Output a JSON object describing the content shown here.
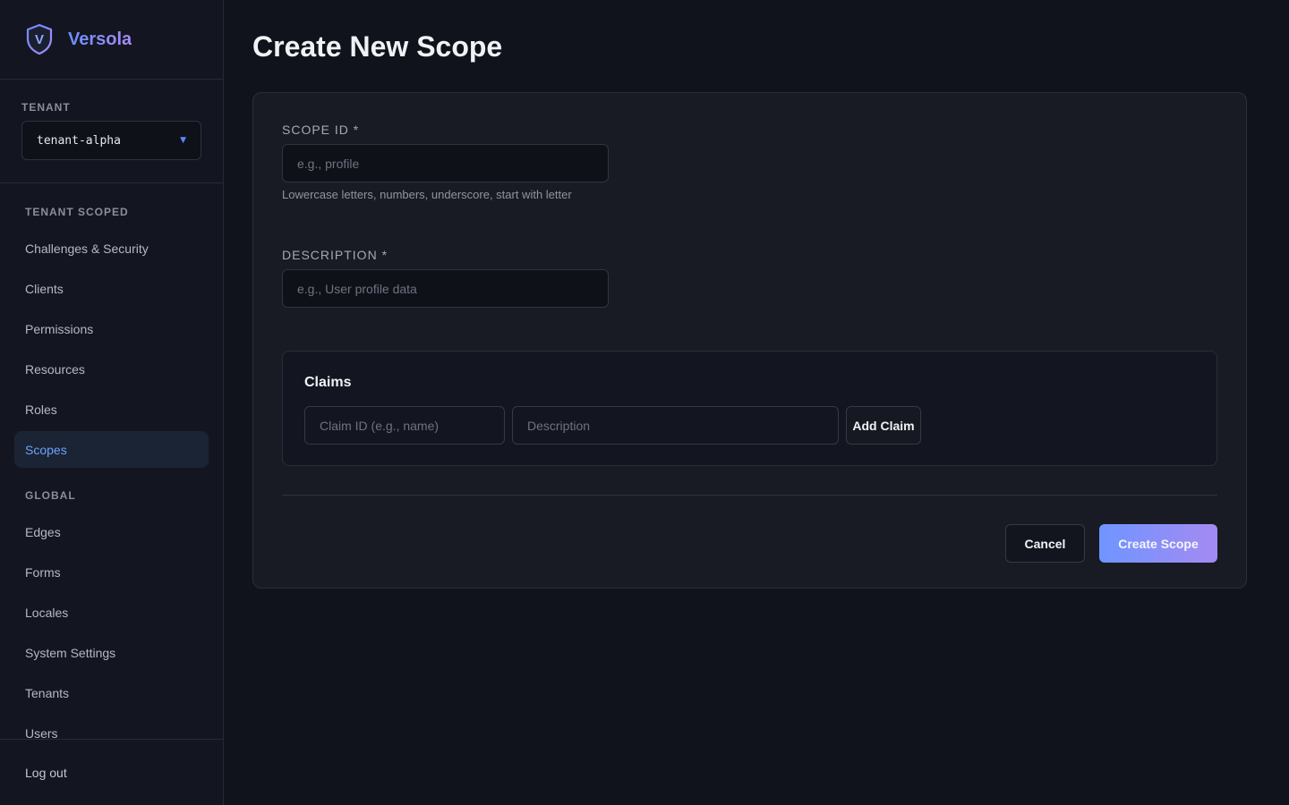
{
  "brand": {
    "name": "Versola",
    "logo_letter": "V",
    "logo_icon": "shield-icon"
  },
  "tenant": {
    "label": "TENANT",
    "selected": "tenant-alpha",
    "caret_icon": "triangle-down-icon"
  },
  "sidebar": {
    "sections": [
      {
        "title": "TENANT SCOPED",
        "items": [
          {
            "label": "Challenges & Security",
            "active": false
          },
          {
            "label": "Clients",
            "active": false
          },
          {
            "label": "Permissions",
            "active": false
          },
          {
            "label": "Resources",
            "active": false
          },
          {
            "label": "Roles",
            "active": false
          },
          {
            "label": "Scopes",
            "active": true
          }
        ]
      },
      {
        "title": "GLOBAL",
        "items": [
          {
            "label": "Edges",
            "active": false
          },
          {
            "label": "Forms",
            "active": false
          },
          {
            "label": "Locales",
            "active": false
          },
          {
            "label": "System Settings",
            "active": false
          },
          {
            "label": "Tenants",
            "active": false
          },
          {
            "label": "Users",
            "active": false
          }
        ]
      }
    ],
    "logout_label": "Log out"
  },
  "page": {
    "title": "Create New Scope"
  },
  "form": {
    "scope_id": {
      "label": "SCOPE ID *",
      "value": "",
      "placeholder": "e.g., profile",
      "hint": "Lowercase letters, numbers, underscore, start with letter"
    },
    "description": {
      "label": "DESCRIPTION *",
      "value": "",
      "placeholder": "e.g., User profile data"
    },
    "claims": {
      "title": "Claims",
      "claim_id_placeholder": "Claim ID (e.g., name)",
      "description_placeholder": "Description",
      "add_label": "Add Claim"
    },
    "cancel_label": "Cancel",
    "submit_label": "Create Scope"
  },
  "colors": {
    "background": "#10131b",
    "sidebar": "#131620",
    "card": "#181b24",
    "accent": "#6fa1ff",
    "gradient_start": "#6f95ff",
    "gradient_end": "#a48af2"
  }
}
